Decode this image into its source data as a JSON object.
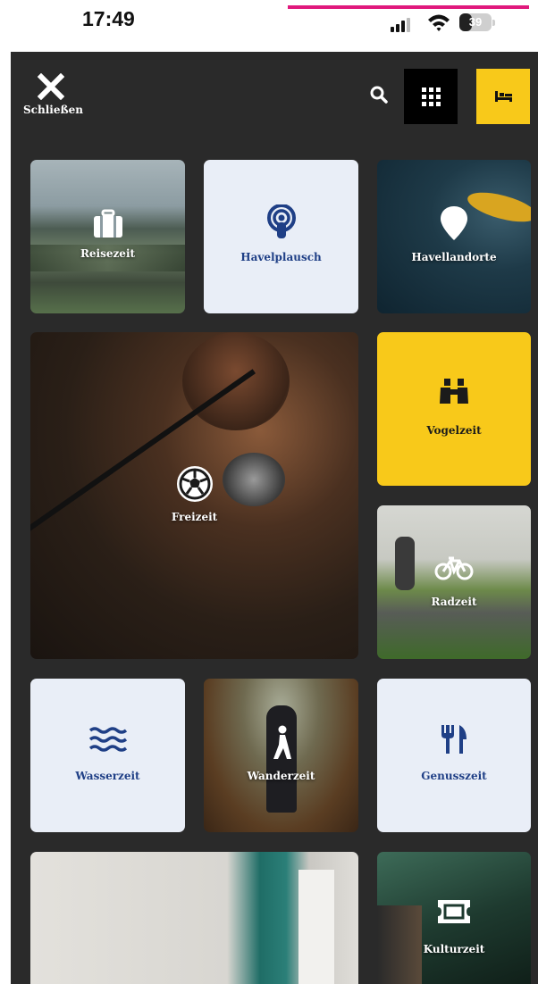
{
  "status_bar": {
    "time": "17:49",
    "battery_level": "39",
    "battery_fraction": 0.39,
    "signal_icon": "cellular-signal-icon",
    "wifi_icon": "wifi-icon",
    "accent_color": "#e0197c"
  },
  "header": {
    "close_label": "Schließen",
    "close_icon": "close-icon",
    "search_icon": "search-icon",
    "grid_icon": "grid-menu-icon",
    "bed_icon": "bed-icon"
  },
  "colors": {
    "background": "#2a2a2a",
    "tile_light": "#e9eef7",
    "tile_yellow": "#f8c91a",
    "label_blue": "#1f3f86"
  },
  "tiles": [
    {
      "label": "Reisezeit",
      "icon": "suitcase-icon",
      "style": "photo"
    },
    {
      "label": "Havelplausch",
      "icon": "podcast-icon",
      "style": "light"
    },
    {
      "label": "Havellandorte",
      "icon": "map-pin-icon",
      "style": "photo"
    },
    {
      "label": "Freizeit",
      "icon": "soccer-ball-icon",
      "style": "photo"
    },
    {
      "label": "Vogelzeit",
      "icon": "binoculars-icon",
      "style": "yellow"
    },
    {
      "label": "Radzeit",
      "icon": "bicycle-icon",
      "style": "photo"
    },
    {
      "label": "Wasserzeit",
      "icon": "waves-icon",
      "style": "light"
    },
    {
      "label": "Wanderzeit",
      "icon": "hiker-icon",
      "style": "photo"
    },
    {
      "label": "Genusszeit",
      "icon": "fork-knife-icon",
      "style": "light"
    },
    {
      "label": "",
      "icon": "",
      "style": "photo"
    },
    {
      "label": "Kulturzeit",
      "icon": "ticket-icon",
      "style": "photo"
    }
  ]
}
